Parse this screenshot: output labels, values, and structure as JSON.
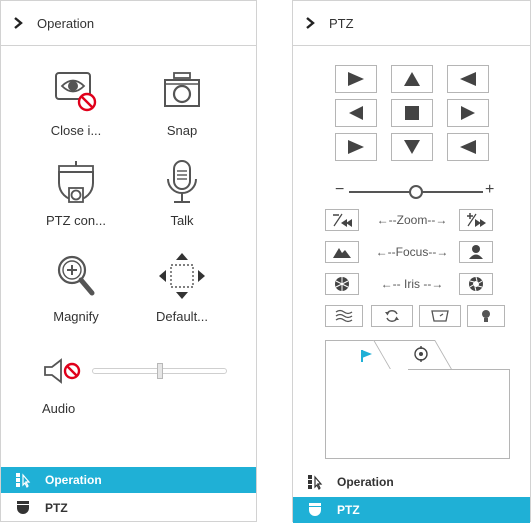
{
  "colors": {
    "accent": "#1fb0d6",
    "icon_dark": "#555555",
    "border": "#b5b5b5",
    "red": "#e0001b"
  },
  "operation_panel": {
    "title": "Operation",
    "items": [
      {
        "label": "Close i...",
        "icon": "close-image-icon"
      },
      {
        "label": "Snap",
        "icon": "camera-icon"
      },
      {
        "label": "PTZ con...",
        "icon": "ptz-camera-icon"
      },
      {
        "label": "Talk",
        "icon": "microphone-icon"
      },
      {
        "label": "Magnify",
        "icon": "magnify-icon"
      },
      {
        "label": "Default...",
        "icon": "default-view-icon"
      }
    ],
    "audio": {
      "label": "Audio",
      "icon": "speaker-muted-icon",
      "volume": 0.5
    }
  },
  "left_nav": [
    {
      "label": "Operation",
      "icon": "operation-icon",
      "active": true
    },
    {
      "label": "PTZ",
      "icon": "ptz-icon",
      "active": false
    }
  ],
  "ptz_panel": {
    "title": "PTZ",
    "speed": {
      "minus": "−",
      "plus": "+",
      "value": 0.5
    },
    "zoom_label": "←--Zoom--→",
    "focus_label": "←--Focus--→",
    "iris_label": "←-- Iris --→",
    "tabs": [
      {
        "icon": "flag-icon",
        "active": true
      },
      {
        "icon": "cruise-icon",
        "active": false
      }
    ]
  },
  "right_nav": [
    {
      "label": "Operation",
      "icon": "operation-icon",
      "active": false
    },
    {
      "label": "PTZ",
      "icon": "ptz-icon",
      "active": true
    }
  ]
}
